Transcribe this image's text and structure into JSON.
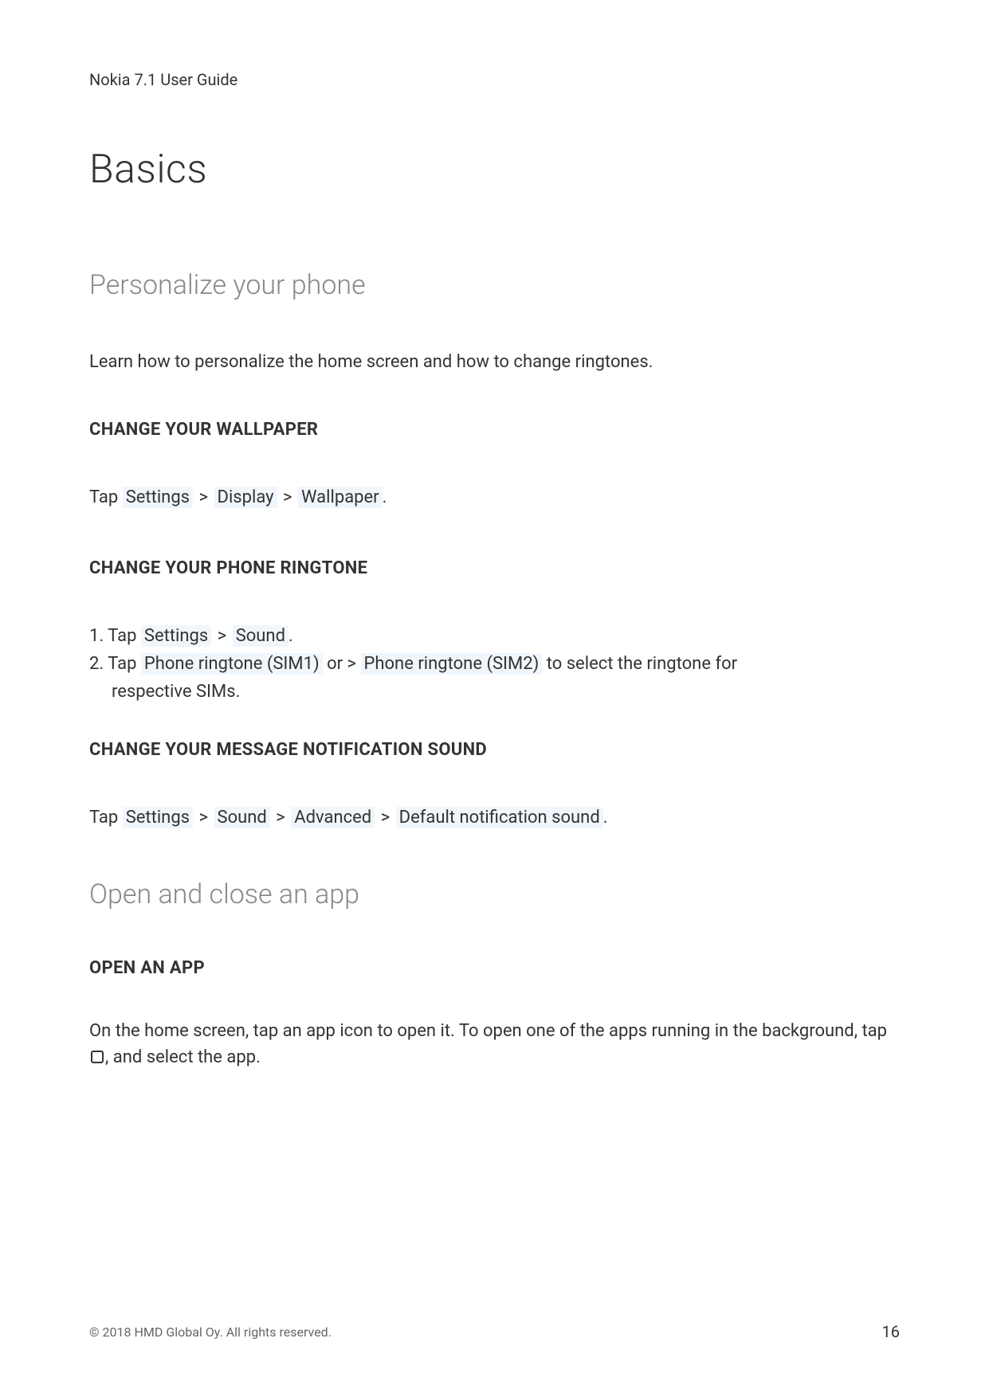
{
  "header": {
    "document_title": "Nokia 7.1 User Guide"
  },
  "chapter": {
    "title": "Basics"
  },
  "sections": {
    "personalize": {
      "title": "Personalize your phone",
      "intro": "Learn how to personalize the home screen and how to change ringtones.",
      "wallpaper": {
        "heading": "CHANGE YOUR WALLPAPER",
        "tap_prefix": "Tap ",
        "step1": "Settings",
        "step2": "Display",
        "step3": "Wallpaper",
        "period": "."
      },
      "ringtone": {
        "heading": "CHANGE YOUR PHONE RINGTONE",
        "item1_prefix": "1. Tap ",
        "item1_step1": "Settings",
        "item1_step2": "Sound",
        "item1_period": ".",
        "item2_prefix": "2. Tap ",
        "item2_step1": "Phone ringtone (SIM1)",
        "item2_or": " or > ",
        "item2_step2": "Phone ringtone (SIM2)",
        "item2_suffix": " to select the ringtone for",
        "item2_line2": "respective SIMs."
      },
      "notification": {
        "heading": "CHANGE YOUR MESSAGE NOTIFICATION SOUND",
        "tap_prefix": "Tap ",
        "step1": "Settings",
        "step2": "Sound",
        "step3": "Advanced",
        "step4": "Default notification sound",
        "period": "."
      }
    },
    "openclose": {
      "title": "Open and close an app",
      "openapp": {
        "heading": "OPEN AN APP",
        "body_part1": "On the home screen, tap an app icon to open it. To open one of the apps running in the background, tap ",
        "body_part2": ", and select the app."
      }
    }
  },
  "footer": {
    "copyright": "© 2018 HMD Global Oy. All rights reserved.",
    "page_number": "16"
  },
  "separator": ">"
}
